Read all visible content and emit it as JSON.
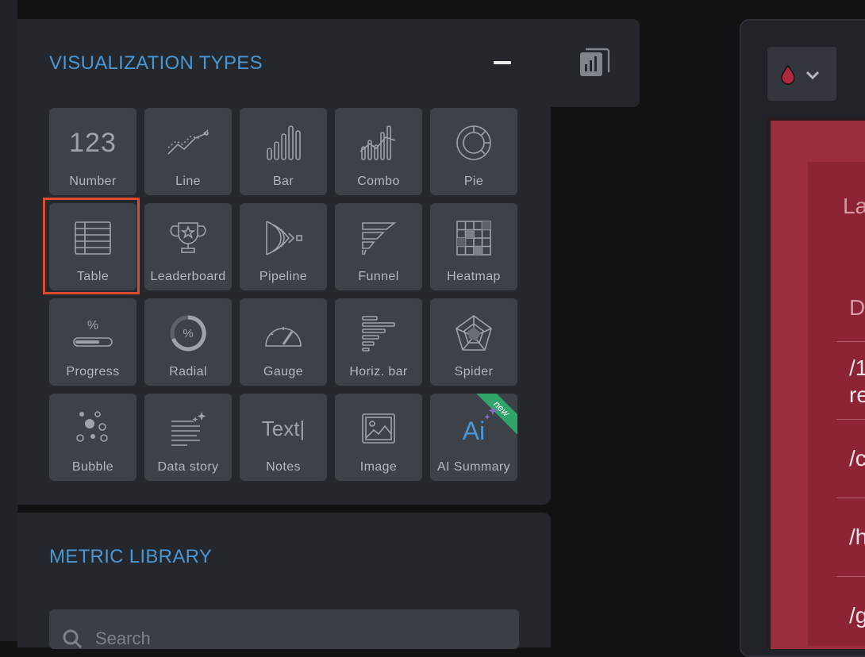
{
  "visualization_types": {
    "title": "VISUALIZATION TYPES",
    "tiles": [
      {
        "label": "Number",
        "icon": "number-123-icon"
      },
      {
        "label": "Line",
        "icon": "line-chart-icon"
      },
      {
        "label": "Bar",
        "icon": "bar-chart-icon"
      },
      {
        "label": "Combo",
        "icon": "combo-chart-icon"
      },
      {
        "label": "Pie",
        "icon": "pie-chart-icon"
      },
      {
        "label": "Table",
        "icon": "table-icon"
      },
      {
        "label": "Leaderboard",
        "icon": "trophy-icon"
      },
      {
        "label": "Pipeline",
        "icon": "pipeline-icon"
      },
      {
        "label": "Funnel",
        "icon": "funnel-icon"
      },
      {
        "label": "Heatmap",
        "icon": "heatmap-icon"
      },
      {
        "label": "Progress",
        "icon": "progress-icon"
      },
      {
        "label": "Radial",
        "icon": "radial-icon"
      },
      {
        "label": "Gauge",
        "icon": "gauge-icon"
      },
      {
        "label": "Horiz. bar",
        "icon": "horizontal-bar-icon"
      },
      {
        "label": "Spider",
        "icon": "spider-chart-icon"
      },
      {
        "label": "Bubble",
        "icon": "bubble-chart-icon"
      },
      {
        "label": "Data story",
        "icon": "data-story-icon"
      },
      {
        "label": "Notes",
        "icon": "notes-text-icon"
      },
      {
        "label": "Image",
        "icon": "image-icon"
      },
      {
        "label": "AI Summary",
        "icon": "ai-summary-icon",
        "badge": "new"
      }
    ],
    "selected": "Table",
    "number_icon_text": "123",
    "notes_icon_text": "Text|",
    "ai_icon_text": "Ai",
    "progress_icon_text": "%",
    "radial_icon_text": "%"
  },
  "metric_library": {
    "title": "METRIC LIBRARY",
    "search_placeholder": "Search"
  },
  "right_panel": {
    "preview_fragments": [
      "La",
      "D",
      "/1",
      "re",
      "/c",
      "/h",
      "/g"
    ]
  },
  "colors": {
    "accent": "#4a97d6",
    "selection": "#e04a2f",
    "new_badge": "#2fa56a",
    "preview_card": "#9c2c40"
  }
}
